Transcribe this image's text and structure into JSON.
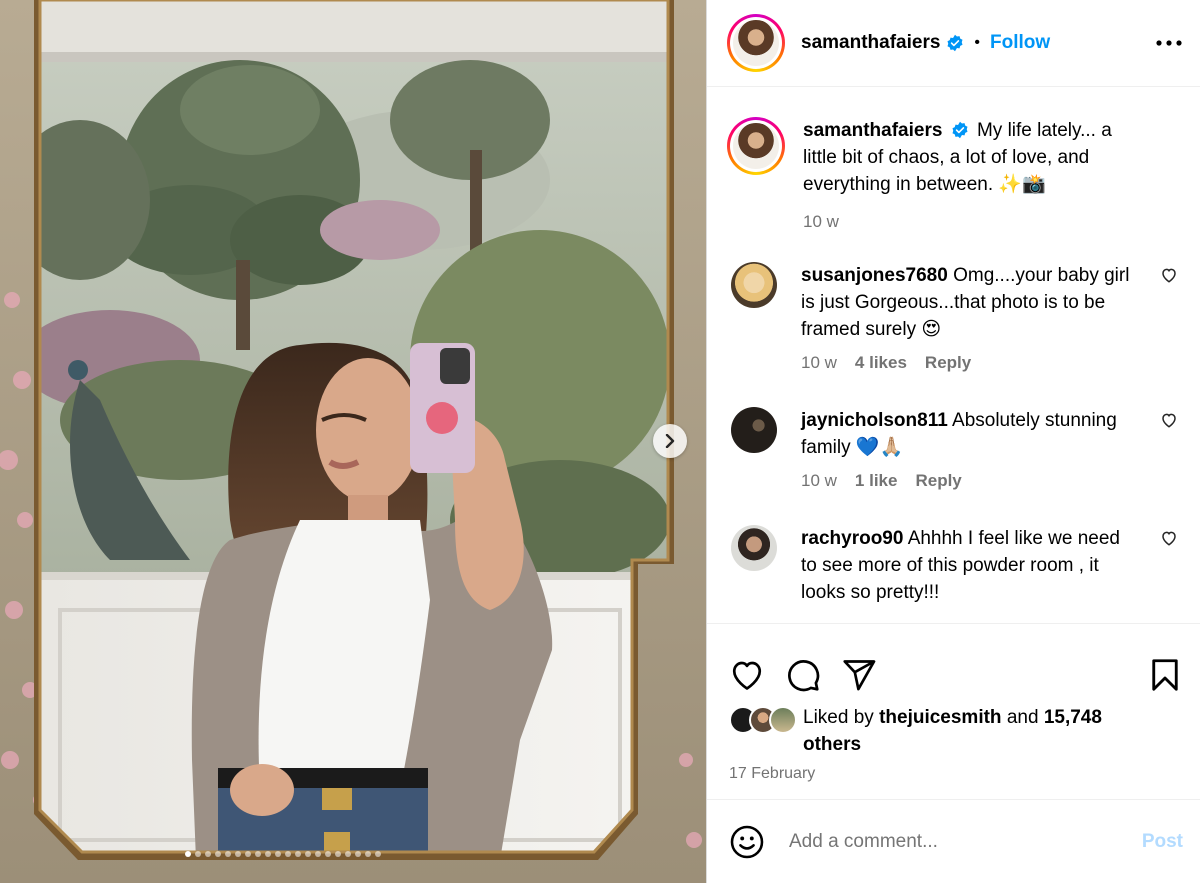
{
  "post_author": {
    "username": "samanthafaiers",
    "verified": true,
    "follow_label": "Follow",
    "separator": "•"
  },
  "caption": {
    "username": "samanthafaiers",
    "text": "My life lately... a little bit of chaos, a lot of love, and everything in between. ✨📸",
    "time": "10 w"
  },
  "comments": [
    {
      "username": "susanjones7680",
      "text": "Omg....your baby girl is just Gorgeous...that photo is to be framed surely 😍",
      "time": "10 w",
      "likes": "4 likes",
      "reply": "Reply"
    },
    {
      "username": "jaynicholson811",
      "text": "Absolutely stunning family 💙🙏🏼",
      "time": "10 w",
      "likes": "1 like",
      "reply": "Reply"
    },
    {
      "username": "rachyroo90",
      "text": "Ahhhh I feel like we need to see more of this powder room , it looks so pretty!!!",
      "time": "",
      "likes": "",
      "reply": ""
    }
  ],
  "likes": {
    "prefix": "Liked by",
    "user": "thejuicesmith",
    "conj": "and",
    "count": "15,748 others"
  },
  "date": "17 February",
  "add_comment": {
    "placeholder": "Add a comment...",
    "post_label": "Post"
  },
  "carousel": {
    "slides": 20,
    "active_index": 0
  },
  "colors": {
    "link_blue": "#0095f6",
    "muted": "#737373",
    "post_disabled": "#b3dbff"
  }
}
